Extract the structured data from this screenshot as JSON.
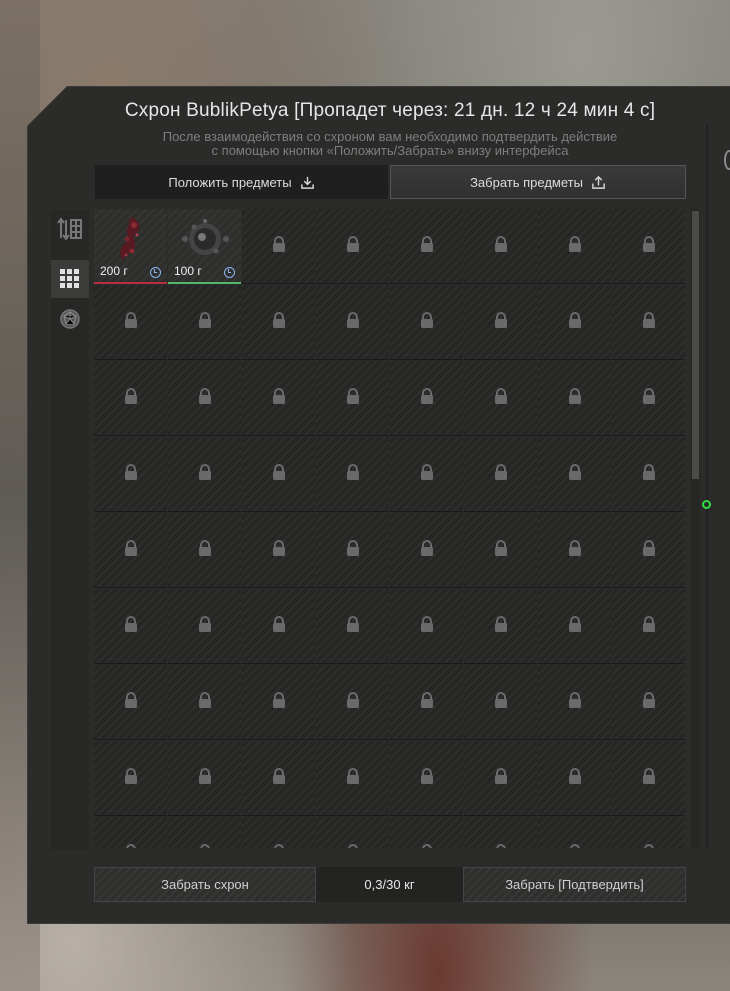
{
  "stash": {
    "title": "Схрон BublikPetya [Пропадет через: 21 дн. 12 ч 24 мин 4 с]",
    "hint_line1": "После взаимодействия со схроном вам необходимо подтвердить действие",
    "hint_line2": "с помощью кнопки «Положить/Забрать» внизу интерфейса"
  },
  "tabs": {
    "put_label": "Положить предметы",
    "take_label": "Забрать предметы",
    "active": "take"
  },
  "sidebar": {
    "icons": [
      "sort-icon",
      "grid-view-icon",
      "artifact-filter-icon"
    ],
    "active": "grid-view-icon"
  },
  "items": [
    {
      "name": "red-crystal-artifact",
      "weight": "200 г",
      "rarity_color": "#b83040",
      "timer": true
    },
    {
      "name": "grey-sphere-artifact",
      "weight": "100 г",
      "rarity_color": "#52b868",
      "timer": true
    }
  ],
  "grid": {
    "columns": 8,
    "visible_rows": 9,
    "locked_icon": "lock-icon"
  },
  "footer": {
    "take_stash_label": "Забрать схрон",
    "capacity": "0,3/30 кг",
    "confirm_label": "Забрать [Подтвердить]"
  },
  "colors": {
    "panel": "#2b2b2a",
    "accent_red": "#b83040",
    "accent_green": "#52b868",
    "timer_blue": "#8ab4f0",
    "cursor_green": "#33dd44"
  }
}
